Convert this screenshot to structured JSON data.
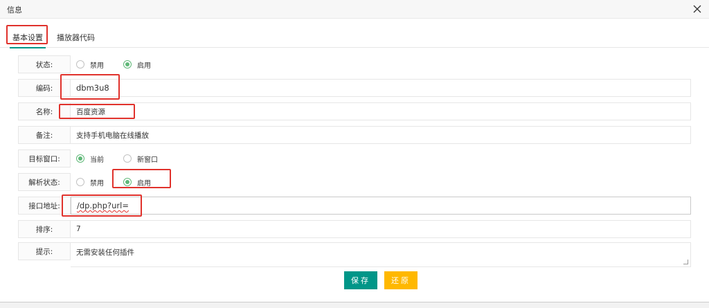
{
  "window": {
    "title": "信息",
    "close_icon": "close-icon"
  },
  "tabs": [
    {
      "label": "基本设置",
      "active": true
    },
    {
      "label": "播放器代码",
      "active": false
    }
  ],
  "form": {
    "status": {
      "label": "状态:",
      "options": [
        "禁用",
        "启用"
      ],
      "selected": "启用"
    },
    "code": {
      "label": "编码:",
      "value": "dbm3u8"
    },
    "name": {
      "label": "名称:",
      "value": "百度资源"
    },
    "remark": {
      "label": "备注:",
      "value": "支持手机电脑在线播放"
    },
    "target": {
      "label": "目标窗口:",
      "options": [
        "当前",
        "新窗口"
      ],
      "selected": "当前"
    },
    "parse_status": {
      "label": "解析状态:",
      "options": [
        "禁用",
        "启用"
      ],
      "selected": "启用"
    },
    "api": {
      "label": "接口地址:",
      "value": "/dp.php?url="
    },
    "sort": {
      "label": "排序:",
      "value": "7"
    },
    "tip": {
      "label": "提示:",
      "value": "无需安装任何插件"
    }
  },
  "actions": {
    "save_label": "保存",
    "reset_label": "还原"
  },
  "colors": {
    "primary": "#009688",
    "warning": "#ffb800",
    "radio_checked": "#5fb878",
    "annotation": "#e0322c"
  }
}
